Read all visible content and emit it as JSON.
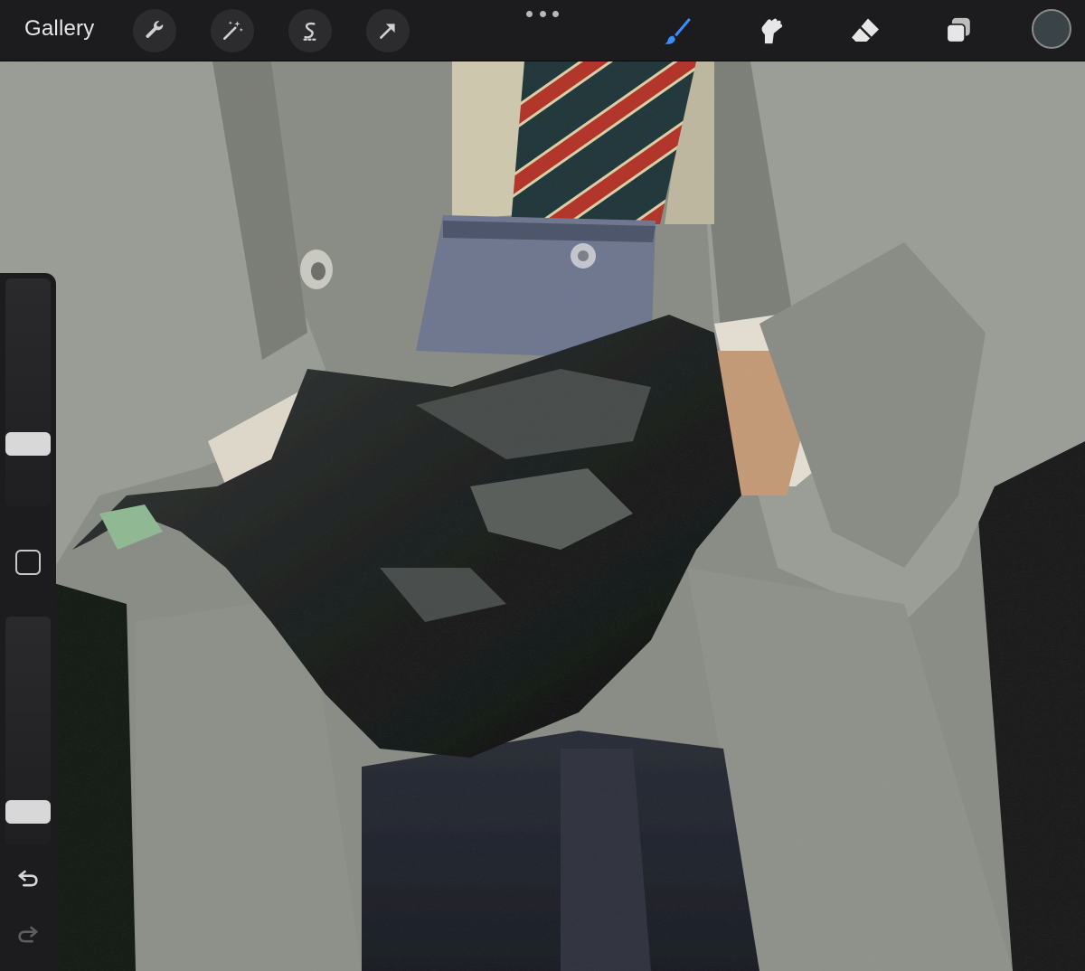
{
  "toolbar": {
    "gallery_label": "Gallery",
    "left_tools": [
      "wrench-icon",
      "magic-wand-icon",
      "selection-icon",
      "transform-arrow-icon"
    ],
    "right_tools": [
      "brush-icon",
      "smudge-icon",
      "eraser-icon",
      "layers-icon"
    ],
    "active_tool": "brush-icon",
    "active_color": "#3a8eff",
    "current_color": "#3a4447"
  },
  "sidebar": {
    "brush_size_level": 0.25,
    "opacity_level": 0.1,
    "buttons": [
      "modify-button",
      "undo-icon",
      "redo-icon"
    ]
  }
}
